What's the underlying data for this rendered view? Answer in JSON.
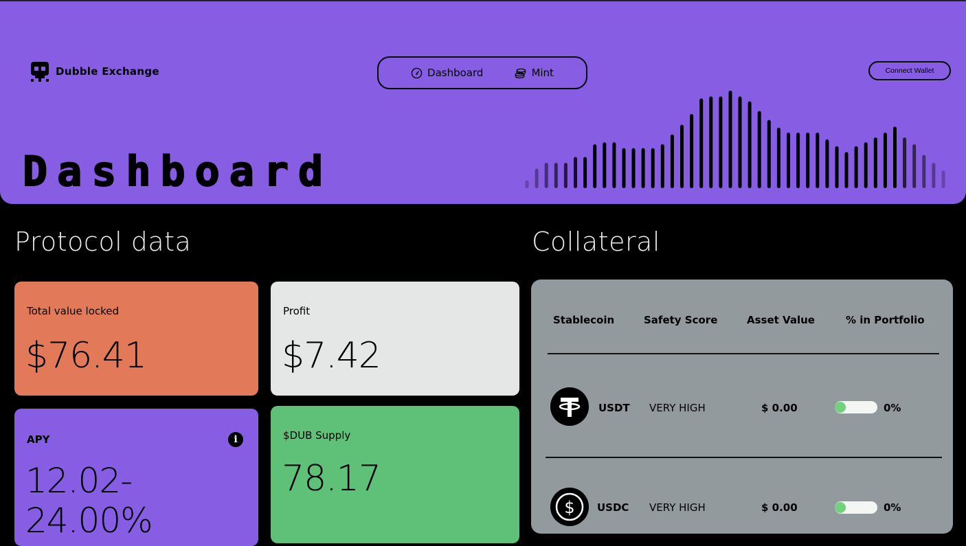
{
  "brand": {
    "name": "Dubble Exchange",
    "icon": "skull-icon"
  },
  "nav": {
    "items": [
      {
        "label": "Dashboard",
        "icon": "gauge-icon"
      },
      {
        "label": "Mint",
        "icon": "coins-icon"
      }
    ]
  },
  "header": {
    "connect_label": "Connect Wallet",
    "title": "Dashboard"
  },
  "decor_bars": [
    0.08,
    0.2,
    0.26,
    0.26,
    0.26,
    0.32,
    0.32,
    0.45,
    0.47,
    0.47,
    0.41,
    0.41,
    0.41,
    0.41,
    0.45,
    0.55,
    0.65,
    0.76,
    0.92,
    0.94,
    0.94,
    1.0,
    0.94,
    0.89,
    0.79,
    0.7,
    0.62,
    0.57,
    0.57,
    0.57,
    0.57,
    0.5,
    0.43,
    0.37,
    0.43,
    0.47,
    0.52,
    0.57,
    0.63,
    0.52,
    0.45,
    0.34,
    0.26,
    0.18
  ],
  "protocol": {
    "title": "Protocol data",
    "tvl": {
      "label": "Total value locked",
      "value": "$76.41"
    },
    "profit": {
      "label": "Profit",
      "value": "$7.42"
    },
    "apy": {
      "label": "APY",
      "value": "12.02-24.00%",
      "icon": "info-icon"
    },
    "supply": {
      "label": "$DUB Supply",
      "value": "78.17"
    }
  },
  "collateral": {
    "title": "Collateral",
    "headers": [
      "Stablecoin",
      "Safety Score",
      "Asset Value",
      "% in Portfolio"
    ],
    "rows": [
      {
        "coin": "USDT",
        "icon": "tether-icon",
        "safety": "VERY HIGH",
        "value": "$ 0.00",
        "pct": "0%",
        "share": 0
      },
      {
        "coin": "USDC",
        "icon": "usdc-icon",
        "safety": "VERY HIGH",
        "value": "$ 0.00",
        "pct": "0%",
        "share": 0
      }
    ]
  },
  "colors": {
    "hero": "#875de3",
    "tvl": "#e27a5a",
    "profit": "#e5e7e6",
    "apy": "#875de3",
    "supply": "#5fc077",
    "collateral": "#929a9e"
  }
}
